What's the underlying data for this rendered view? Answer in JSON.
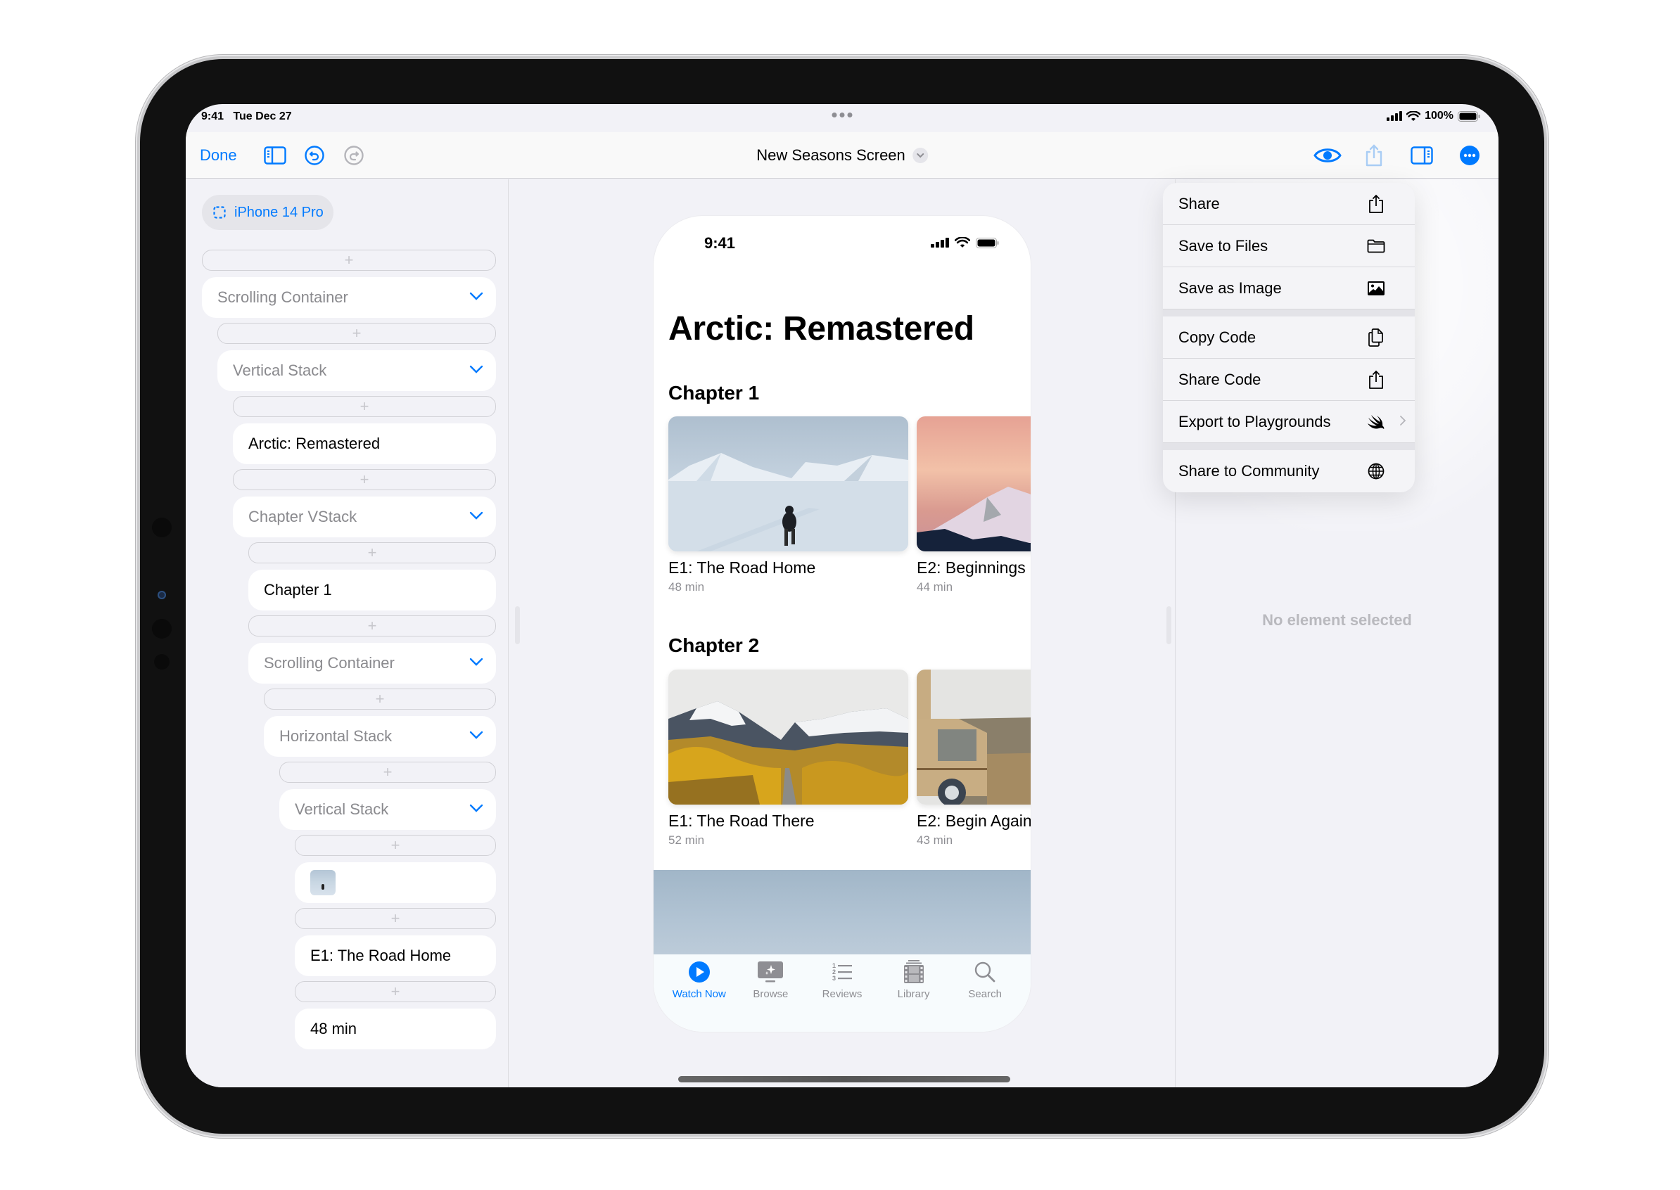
{
  "status_bar": {
    "time": "9:41",
    "date": "Tue Dec 27",
    "battery": "100%"
  },
  "toolbar": {
    "done_label": "Done",
    "document_title": "New Seasons Screen"
  },
  "sidebar": {
    "device": "iPhone 14 Pro",
    "tree": [
      {
        "label": "Scrolling Container",
        "type": "container",
        "depth": 0
      },
      {
        "label": "Vertical Stack",
        "type": "container",
        "depth": 1
      },
      {
        "label": "Arctic: Remastered",
        "type": "text",
        "depth": 2
      },
      {
        "label": "Chapter VStack",
        "type": "container",
        "depth": 2
      },
      {
        "label": "Chapter 1",
        "type": "text",
        "depth": 3
      },
      {
        "label": "Scrolling Container",
        "type": "container",
        "depth": 3
      },
      {
        "label": "Horizontal Stack",
        "type": "container",
        "depth": 4
      },
      {
        "label": "Vertical Stack",
        "type": "container",
        "depth": 5
      },
      {
        "label": "",
        "type": "image",
        "depth": 6
      },
      {
        "label": "E1: The Road Home",
        "type": "text",
        "depth": 6
      },
      {
        "label": "48 min",
        "type": "text",
        "depth": 6
      }
    ]
  },
  "preview": {
    "time": "9:41",
    "title": "Arctic: Remastered",
    "chapters": [
      {
        "title": "Chapter 1",
        "episodes": [
          {
            "title": "E1: The Road Home",
            "duration": "48 min"
          },
          {
            "title": "E2: Beginnings",
            "duration": "44 min"
          }
        ]
      },
      {
        "title": "Chapter 2",
        "episodes": [
          {
            "title": "E1: The Road There",
            "duration": "52 min"
          },
          {
            "title": "E2: Begin Again",
            "duration": "43 min"
          }
        ]
      }
    ],
    "tabs": [
      {
        "label": "Watch Now",
        "icon": "play-circle-icon",
        "active": true
      },
      {
        "label": "Browse",
        "icon": "tv-sparkle-icon",
        "active": false
      },
      {
        "label": "Reviews",
        "icon": "numbered-list-icon",
        "active": false
      },
      {
        "label": "Library",
        "icon": "film-stack-icon",
        "active": false
      },
      {
        "label": "Search",
        "icon": "magnifying-glass-icon",
        "active": false
      }
    ]
  },
  "inspector": {
    "empty_text": "No element selected"
  },
  "menu": {
    "groups": [
      [
        {
          "label": "Share",
          "icon": "share-icon"
        },
        {
          "label": "Save to Files",
          "icon": "folder-icon"
        },
        {
          "label": "Save as Image",
          "icon": "photo-icon"
        }
      ],
      [
        {
          "label": "Copy Code",
          "icon": "copy-doc-icon"
        },
        {
          "label": "Share Code",
          "icon": "share-icon"
        },
        {
          "label": "Export to Playgrounds",
          "icon": "swift-icon",
          "submenu": true
        }
      ],
      [
        {
          "label": "Share to Community",
          "icon": "globe-icon"
        }
      ]
    ]
  },
  "colors": {
    "accent": "#007aff",
    "background": "#f2f2f7",
    "secondary_text": "#8e8e93"
  }
}
